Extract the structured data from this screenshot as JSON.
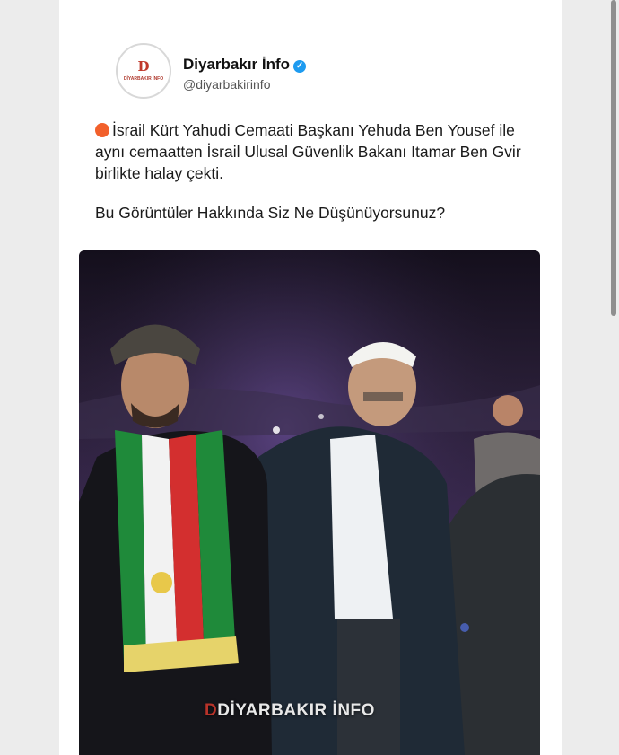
{
  "account": {
    "name": "Diyarbakır İnfo",
    "handle": "@diyarbakirinfo",
    "avatar_letter": "D",
    "avatar_subtext": "DİYARBAKIR İNFO",
    "verified": true
  },
  "post": {
    "body": "İsrail Kürt Yahudi Cemaati Başkanı Yehuda Ben Yousef ile aynı cemaatten İsrail Ulusal Güvenlik Bakanı Itamar Ben Gvir birlikte halay çekti.",
    "question": "Bu Görüntüler Hakkında Siz Ne Düşünüyorsunuz?"
  },
  "media": {
    "watermark_letter": "D",
    "watermark_text": "DİYARBAKIR İNFO"
  },
  "colors": {
    "verified": "#1d9bf0",
    "bullet": "#f2602b",
    "brand": "#c0392b"
  }
}
